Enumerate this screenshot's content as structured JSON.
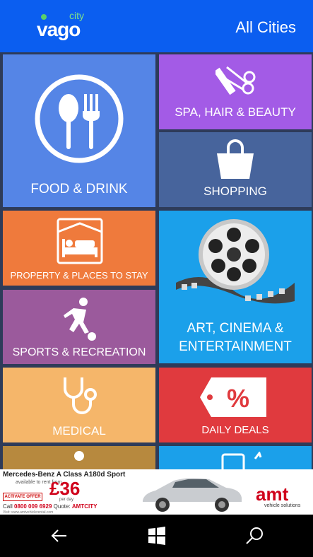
{
  "header": {
    "logo_text": "vago",
    "logo_suffix": "city",
    "location_label": "All Cities"
  },
  "tiles": [
    {
      "key": "food",
      "label": "FOOD & DRINK",
      "icon": "fork-spoon-icon",
      "color": "#5585e6"
    },
    {
      "key": "spa",
      "label": "SPA, HAIR & BEAUTY",
      "icon": "scissors-comb-icon",
      "color": "#a35be6"
    },
    {
      "key": "shopping",
      "label": "SHOPPING",
      "icon": "shopping-bag-icon",
      "color": "#47649c"
    },
    {
      "key": "property",
      "label": "PROPERTY & PLACES TO STAY",
      "icon": "bed-icon",
      "color": "#ef7a3c"
    },
    {
      "key": "art",
      "label_line1": "ART, CINEMA &",
      "label_line2": "ENTERTAINMENT",
      "icon": "film-reel-icon",
      "color": "#1ba0ea"
    },
    {
      "key": "sports",
      "label": "SPORTS & RECREATION",
      "icon": "football-player-icon",
      "color": "#9b5a9c"
    },
    {
      "key": "medical",
      "label": "MEDICAL",
      "icon": "stethoscope-icon",
      "color": "#f5b66a"
    },
    {
      "key": "deals",
      "label": "DAILY DEALS",
      "icon": "discount-tag-icon",
      "color": "#e03a3e"
    }
  ],
  "ad": {
    "title": "Mercedes-Benz A Class A180d Sport",
    "subtitle": "available to rent from",
    "cta": "ACTIVATE OFFER",
    "price": "£36",
    "price_unit": "per day",
    "call_prefix": "Call",
    "phone": "0800 009 6929",
    "quote_label": "Quote:",
    "quote_code": "AMTCITY",
    "website": "Visit: www.amtvehiclerental.com",
    "brand": "amt",
    "brand_sub": "vehicle solutions"
  },
  "navbar": {
    "back": "back-arrow-icon",
    "home": "windows-logo-icon",
    "search": "search-icon"
  }
}
